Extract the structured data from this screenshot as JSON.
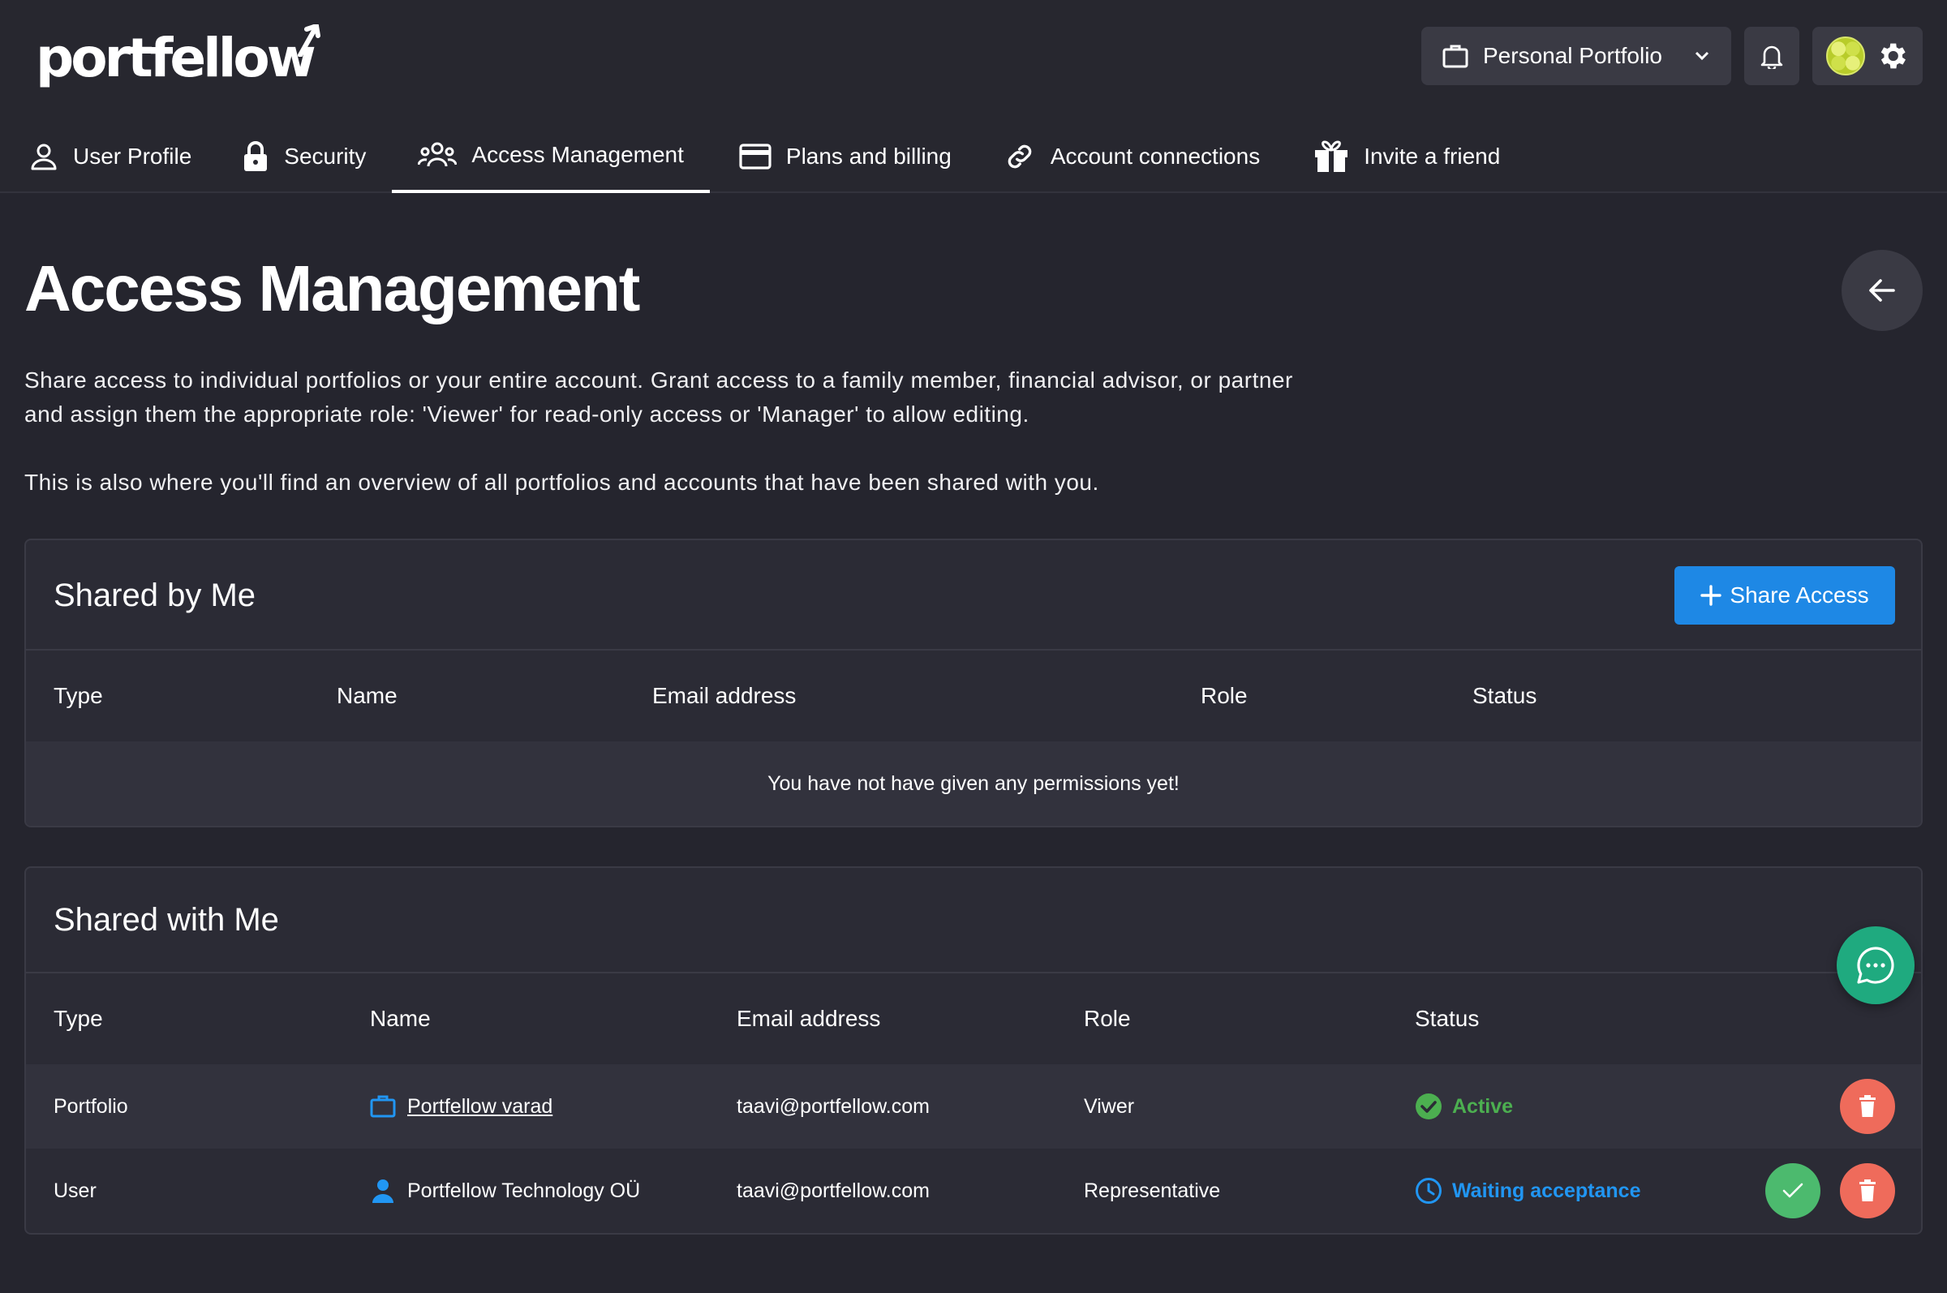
{
  "app": {
    "logo_text": "portfellow"
  },
  "header": {
    "portfolio_selector": "Personal Portfolio"
  },
  "tabs": [
    {
      "label": "User Profile",
      "icon": "user-icon"
    },
    {
      "label": "Security",
      "icon": "lock-icon"
    },
    {
      "label": "Access Management",
      "icon": "users-icon",
      "active": true
    },
    {
      "label": "Plans and billing",
      "icon": "credit-card-icon"
    },
    {
      "label": "Account connections",
      "icon": "link-icon"
    },
    {
      "label": "Invite a friend",
      "icon": "gift-icon"
    }
  ],
  "page": {
    "title": "Access Management",
    "description_1": "Share access to individual portfolios or your entire account. Grant access to a family member, financial advisor, or partner and assign them the appropriate role: 'Viewer' for read-only access or 'Manager' to allow editing.",
    "description_2": "This is also where you'll find an overview of all portfolios and accounts that have been shared with you."
  },
  "shared_by_me": {
    "title": "Shared by Me",
    "share_button": "Share Access",
    "columns": [
      "Type",
      "Name",
      "Email address",
      "Role",
      "Status"
    ],
    "empty_message": "You have not have given any permissions yet!"
  },
  "shared_with_me": {
    "title": "Shared with Me",
    "columns": [
      "Type",
      "Name",
      "Email address",
      "Role",
      "Status"
    ],
    "rows": [
      {
        "type": "Portfolio",
        "name": "Portfellow varad",
        "name_icon": "briefcase-icon",
        "email": "taavi@portfellow.com",
        "role": "Viwer",
        "status": "Active",
        "status_icon": "check-circle-icon"
      },
      {
        "type": "User",
        "name": "Portfellow Technology OÜ",
        "name_icon": "person-icon",
        "email": "taavi@portfellow.com",
        "role": "Representative",
        "status": "Waiting acceptance",
        "status_icon": "clock-icon"
      }
    ]
  },
  "colors": {
    "background": "#25252e",
    "card": "#2b2b35",
    "primary": "#1e88e5",
    "active_status": "#4caf50",
    "waiting_status": "#2196f3",
    "delete": "#ef6b5b",
    "accept": "#4cba6e",
    "chat": "#1faa7f"
  }
}
